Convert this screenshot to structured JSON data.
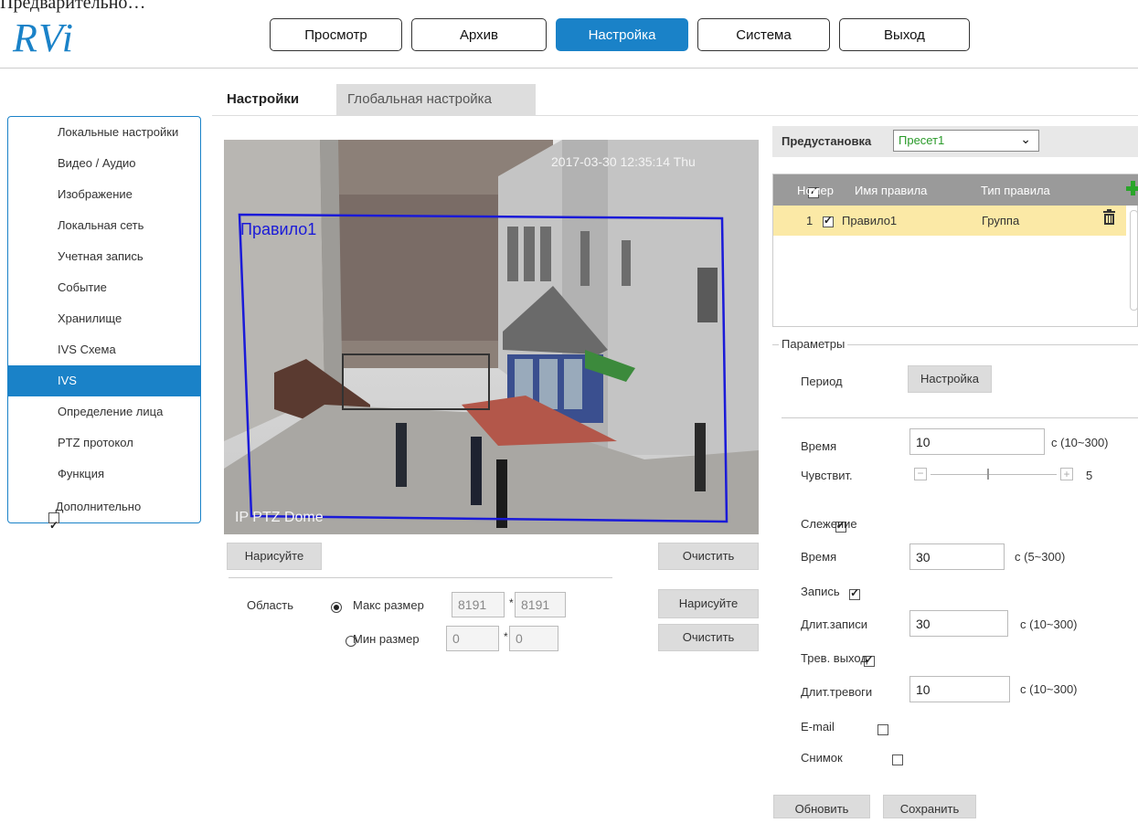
{
  "top_cut_text": "Предварительно…",
  "logo": "RVi",
  "nav": [
    "Просмотр",
    "Архив",
    "Настройка",
    "Система",
    "Выход"
  ],
  "tabs": [
    "Настройки",
    "Глобальная настройка"
  ],
  "sidebar": {
    "items": [
      "Локальные настройки",
      "Видео / Аудио",
      "Изображение",
      "Локальная сеть",
      "Учетная запись",
      "Событие",
      "Хранилище",
      "IVS Схема",
      "IVS",
      "Определение лица",
      "PTZ протокол",
      "Функция"
    ],
    "extra": "Дополнительно"
  },
  "video": {
    "timestamp": "2017-03-30 12:35:14 Thu",
    "channel": "IP PTZ Dome",
    "rule_label": "Правило1"
  },
  "draw_label": "Нарисуйте",
  "clear_label": "Очистить",
  "area": {
    "label": "Область",
    "max_label": "Макс размер",
    "max_w": "8191",
    "max_h": "8191",
    "min_label": "Мин размер",
    "min_w": "0",
    "min_h": "0",
    "times": "*"
  },
  "preset": {
    "label": "Предустановка",
    "value": "Пресет1"
  },
  "rules": {
    "headers": [
      "Номер",
      "Имя правила",
      "Тип правила"
    ],
    "rows": [
      {
        "num": "1",
        "name": "Правило1",
        "type": "Группа"
      }
    ]
  },
  "params": {
    "legend": "Параметры",
    "period_label": "Период",
    "setup_btn": "Настройка",
    "time_label": "Время",
    "time_val": "10",
    "time_range": "с (10~300)",
    "sens_label": "Чувствит.",
    "sens_val": "5",
    "sens_level": 0.45,
    "tracking_label": "Слежение",
    "track_time_label": "Время",
    "track_time_val": "30",
    "track_time_range": "с (5~300)",
    "record_label": "Запись",
    "rec_dur_label": "Длит.записи",
    "rec_dur_val": "30",
    "rec_dur_range": "с (10~300)",
    "alarm_label": "Трев. выход",
    "alarm_dur_label": "Длит.тревоги",
    "alarm_dur_val": "10",
    "alarm_dur_range": "с (10~300)",
    "email_label": "E-mail",
    "snapshot_label": "Снимок"
  },
  "footer": {
    "refresh": "Обновить",
    "save": "Сохранить"
  },
  "colors": {
    "accent": "#1a82c8",
    "rule_box": "#1a1ad8",
    "row_highlight": "#fbe9a6",
    "table_header": "#9a9a9a",
    "add_icon": "#2aa52a"
  }
}
